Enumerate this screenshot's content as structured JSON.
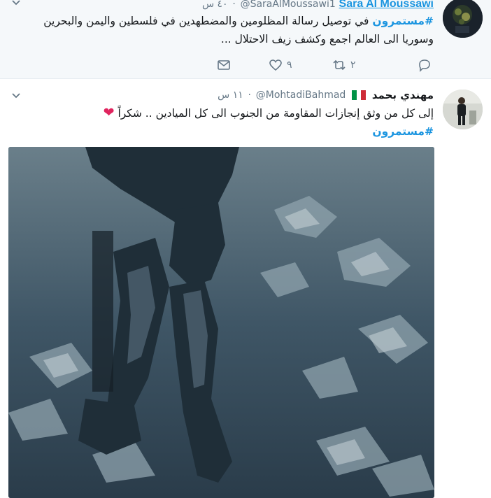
{
  "tweet1": {
    "display_name": "Sara Al Moussawi",
    "handle": "@SaraAlMoussawi1",
    "time": "٤٠ س",
    "hashtag": "#مستمرون",
    "text_line1": " في توصيل رسالة  المظلومين والمضطهدين في فلسطين واليمن والبحرين",
    "text_line2": "وسوريا الى العالم اجمع وكشف زيف الاحتلال ...",
    "retweets": "٢",
    "likes": "٩",
    "icons": [
      "reply-icon",
      "retweet-icon",
      "like-icon",
      "message-icon",
      "chevron-down-icon"
    ]
  },
  "tweet2": {
    "display_name": "مهندي بحمد",
    "handle": "@MohtadiBahmad",
    "time": "١١ س",
    "text_line1": "إلى كل من وثق إنجازات المقاومة من الجنوب الى كل الميادين  .. شكراً",
    "hashtag": "#مستمرون",
    "heart": "❤",
    "flag_colors": [
      "#009246",
      "#ffffff",
      "#ce2b37"
    ],
    "icons": [
      "chevron-down-icon",
      "italy-flag-icon",
      "heart-icon"
    ]
  },
  "separator": "·",
  "colors": {
    "link": "#1b95e0",
    "muted": "#657786",
    "highlight_bg": "#f5f8fa"
  }
}
